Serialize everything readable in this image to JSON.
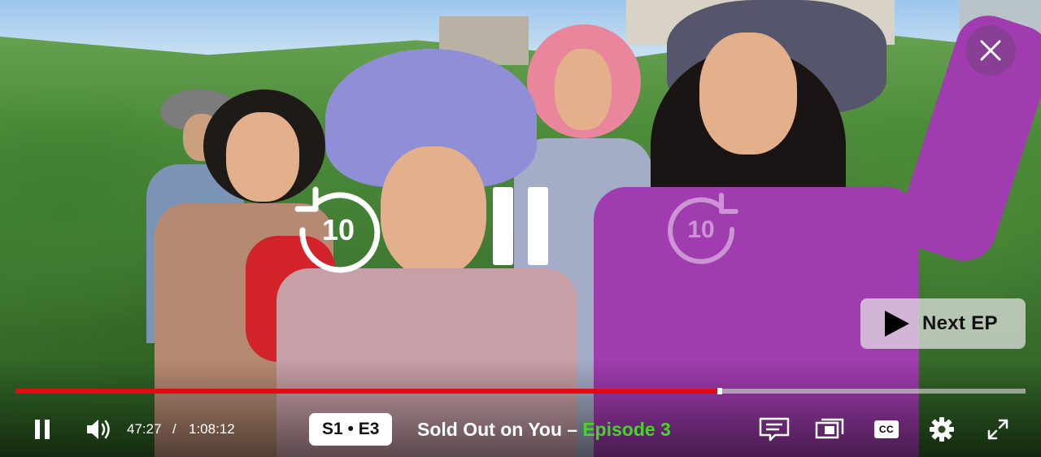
{
  "player": {
    "current_time": "47:27",
    "separator": "/",
    "duration": "1:08:12",
    "progress_fraction": 0.697,
    "accent_color": "#e50914"
  },
  "overlay": {
    "rewind_seconds": "10",
    "forward_seconds": "10",
    "next_episode_label": "Next EP"
  },
  "episode": {
    "badge": "S1 • E3",
    "show_title": "Sold Out on You –",
    "episode_label": "Episode 3",
    "episode_label_color": "#46d42a"
  },
  "icons": {
    "close": "close-icon",
    "rewind": "rewind-10-icon",
    "pause": "pause-icon",
    "forward": "forward-10-icon",
    "next": "play-icon",
    "volume": "volume-icon",
    "episodes_list": "episodes-list-icon",
    "display": "display-mode-icon",
    "captions": "cc-icon",
    "settings": "gear-icon",
    "fullscreen": "fullscreen-icon"
  },
  "captions_label": "CC"
}
